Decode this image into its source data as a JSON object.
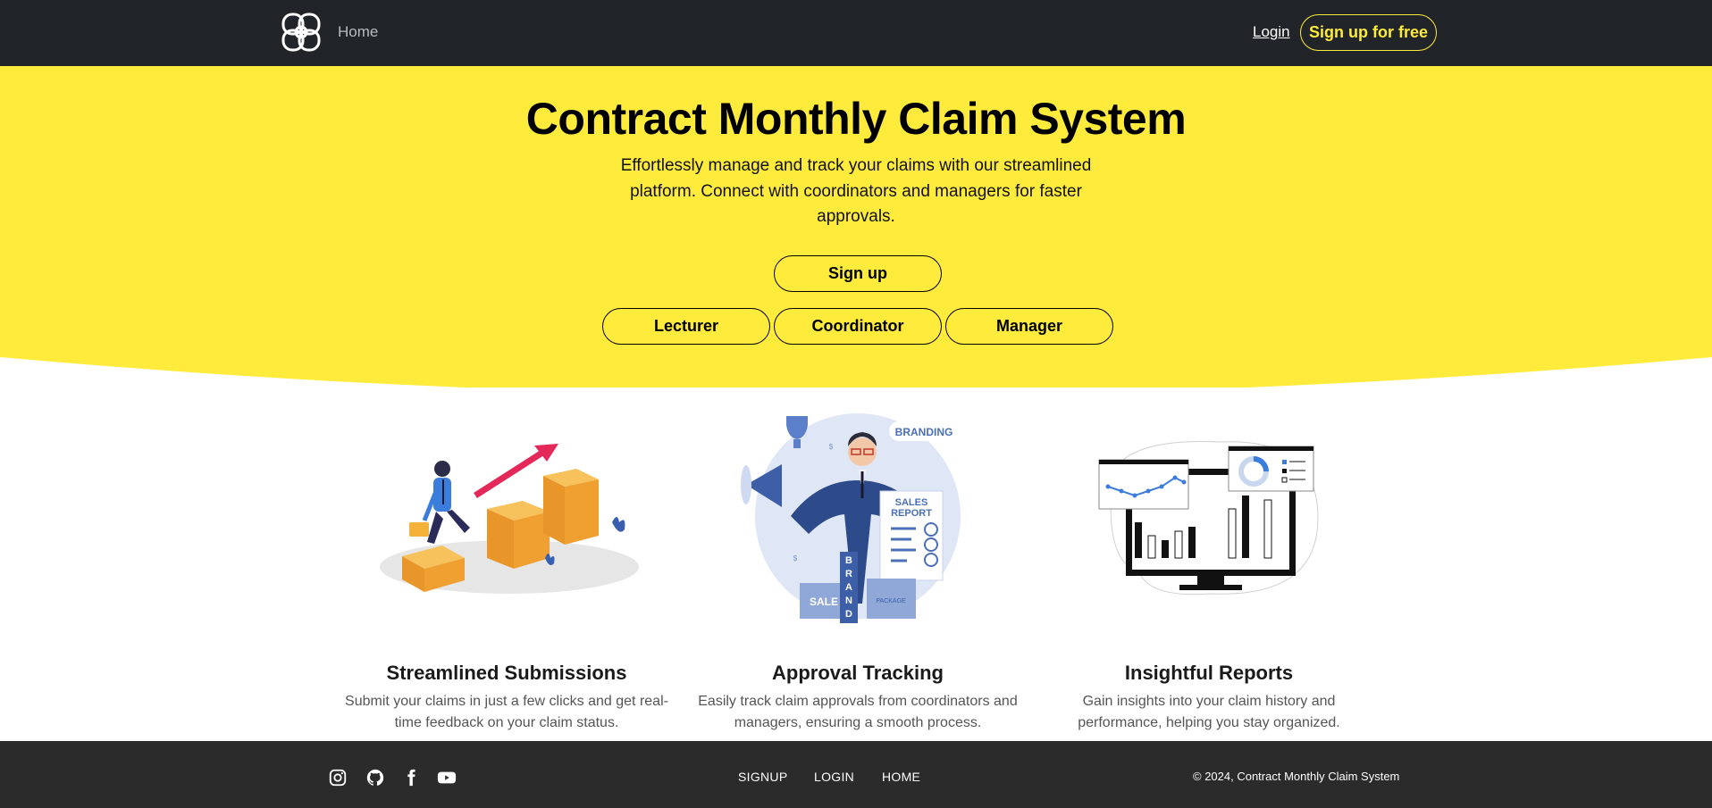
{
  "nav": {
    "home_label": "Home",
    "login_label": "Login",
    "signup_label": "Sign up for free"
  },
  "hero": {
    "title": "Contract Monthly Claim System",
    "description": "Effortlessly manage and track your claims with our streamlined platform. Connect with coordinators and managers for faster approvals.",
    "signup_button": "Sign up",
    "role_buttons": [
      "Lecturer",
      "Coordinator",
      "Manager"
    ]
  },
  "features": [
    {
      "title": "Streamlined Submissions",
      "description": "Submit your claims in just a few clicks and get real-time feedback on your claim status."
    },
    {
      "title": "Approval Tracking",
      "description": "Easily track claim approvals from coordinators and managers, ensuring a smooth process."
    },
    {
      "title": "Insightful Reports",
      "description": "Gain insights into your claim history and performance, helping you stay organized."
    }
  ],
  "illustration_text": {
    "branding": "BRANDING",
    "sales": "SALES",
    "report": "REPORT",
    "sale": "SALE",
    "package": "PACKAGE",
    "brand_letters": [
      "B",
      "R",
      "A",
      "N",
      "D"
    ],
    "dollar": "$"
  },
  "footer": {
    "links": [
      "SIGNUP",
      "LOGIN",
      "HOME"
    ],
    "copyright": "© 2024, Contract Monthly Claim System",
    "social_icons": [
      "instagram-icon",
      "github-icon",
      "facebook-icon",
      "youtube-icon"
    ]
  },
  "colors": {
    "navbar": "#212529",
    "accent_yellow": "#ffeb3b",
    "footer": "#2b2b2b"
  }
}
